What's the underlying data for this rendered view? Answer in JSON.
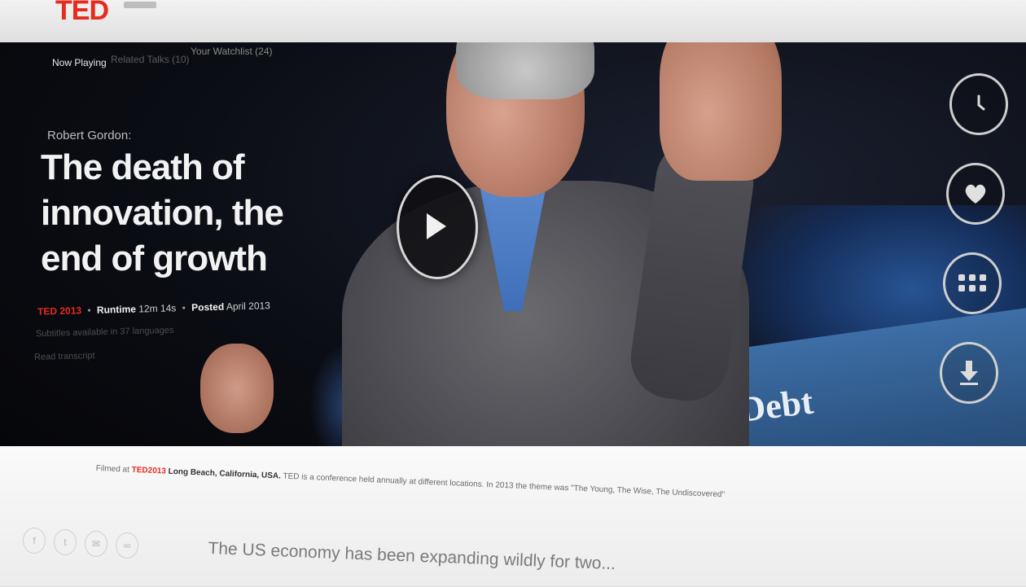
{
  "brand": {
    "logo": "TED"
  },
  "tabs": [
    {
      "label": "Now Playing"
    },
    {
      "label": "Related Talks (10)"
    },
    {
      "label": "Your Watchlist (24)"
    }
  ],
  "talk": {
    "speaker": "Robert Gordon:",
    "title": "The death of innovation, the end of growth",
    "event": "TED 2013",
    "runtime_label": "Runtime",
    "runtime": "12m 14s",
    "posted_label": "Posted",
    "posted": "April 2013",
    "subtitles": "Subtitles available in 37 languages",
    "transcript": "Read transcript",
    "stage_screen": "wind: Debt"
  },
  "side_actions": [
    {
      "icon": "clock-icon"
    },
    {
      "icon": "heart-icon"
    },
    {
      "icon": "grid-icon"
    },
    {
      "icon": "download-icon"
    }
  ],
  "caption": {
    "prefix": "Filmed at",
    "event": "TED2013",
    "location": "Long Beach, California, USA.",
    "text": "TED is a conference held annually at different locations. In 2013 the theme was \"The Young, The Wise, The Undiscovered\""
  },
  "share_icons": [
    "facebook-icon",
    "twitter-icon",
    "email-icon",
    "link-icon"
  ],
  "description": "The US economy has been expanding wildly for two..."
}
